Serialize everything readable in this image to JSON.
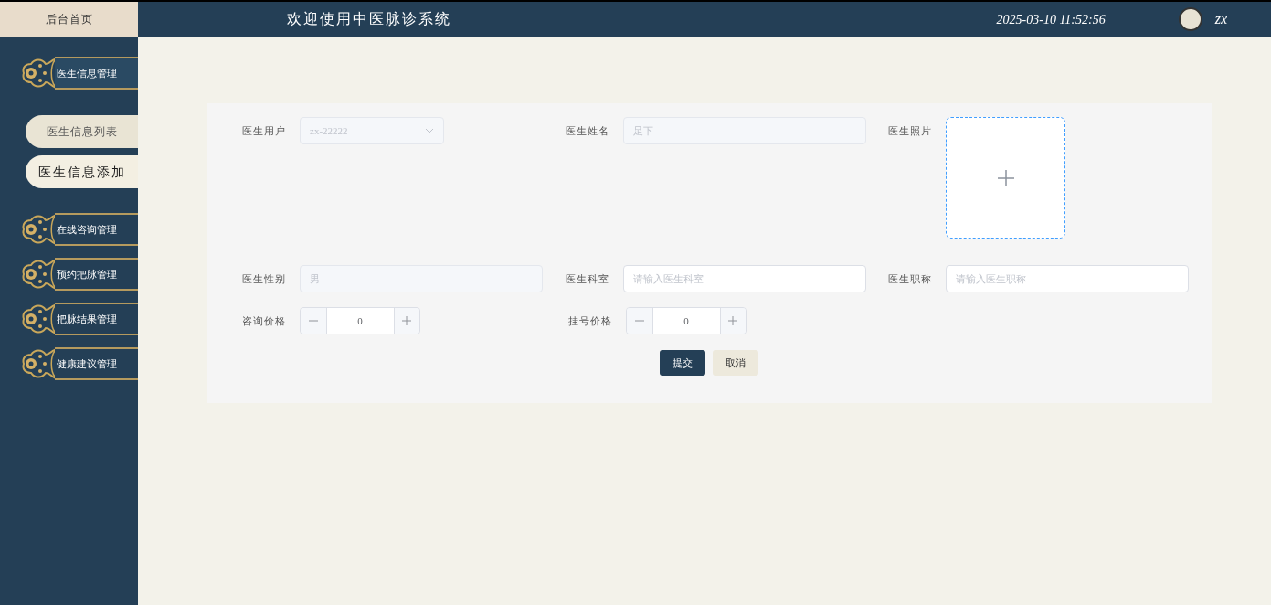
{
  "sidebar": {
    "home": "后台首页",
    "groups": [
      {
        "label": "医生信息管理",
        "expanded": true,
        "children": [
          {
            "label": "医生信息列表",
            "selected": false
          },
          {
            "label": "医生信息添加",
            "selected": true
          }
        ]
      },
      {
        "label": "在线咨询管理",
        "expanded": false
      },
      {
        "label": "预约把脉管理",
        "expanded": false
      },
      {
        "label": "把脉结果管理",
        "expanded": false
      },
      {
        "label": "健康建议管理",
        "expanded": false
      }
    ]
  },
  "header": {
    "title": "欢迎使用中医脉诊系统",
    "datetime": "2025-03-10 11:52:56",
    "user": "zx"
  },
  "form": {
    "rows": [
      [
        {
          "label": "医生用户",
          "kind": "select",
          "value": "zx-22222",
          "disabled": true
        },
        {
          "label": "医生姓名",
          "kind": "input",
          "value": "足下",
          "disabled": true
        },
        {
          "label": "医生照片",
          "kind": "upload"
        }
      ],
      [
        {
          "label": "医生性别",
          "kind": "input",
          "value": "男",
          "disabled": true
        },
        {
          "label": "医生科室",
          "kind": "input",
          "placeholder": "请输入医生科室"
        },
        {
          "label": "医生职称",
          "kind": "input",
          "placeholder": "请输入医生职称"
        }
      ],
      [
        {
          "label": "咨询价格",
          "kind": "number",
          "value": "0"
        },
        {
          "label": "挂号价格",
          "kind": "number",
          "value": "0"
        }
      ]
    ],
    "buttons": [
      {
        "label": "提交",
        "kind": "primary"
      },
      {
        "label": "取消",
        "kind": "secondary"
      }
    ]
  }
}
